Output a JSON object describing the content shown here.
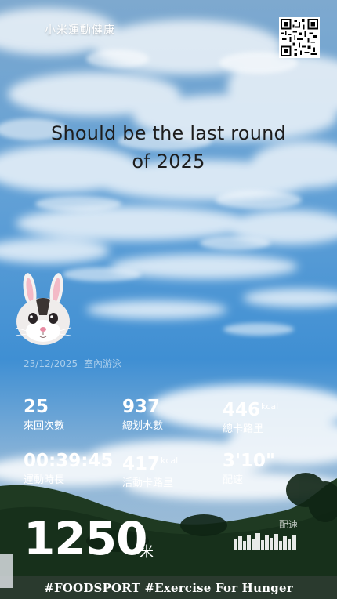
{
  "app": {
    "brand": "小米運動健康"
  },
  "headline": {
    "line1": "Should be the last round",
    "line2": "of 2025"
  },
  "workout": {
    "date": "23/12/2025",
    "type": "室內游泳"
  },
  "stats": [
    {
      "value": "25",
      "unit": "",
      "label": "來回次數"
    },
    {
      "value": "937",
      "unit": "",
      "label": "總划水數"
    },
    {
      "value": "446",
      "unit": "kcal",
      "label": "總卡路里"
    },
    {
      "value": "00:39:45",
      "unit": "",
      "label": "運動時長"
    },
    {
      "value": "417",
      "unit": "kcal",
      "label": "活動卡路里"
    },
    {
      "value": "3'10\"",
      "unit": "",
      "label": "配速"
    }
  ],
  "distance": {
    "value": "1250",
    "unit": "米"
  },
  "pace_chart": {
    "label": "配速"
  },
  "footer": {
    "hashtags": "#FOODSPORT #Exercise For Hunger"
  },
  "colors": {
    "sky": "#5f9fd6",
    "headline": "#1d1d1d",
    "text": "#ffffff"
  },
  "icons": [
    "qr-code-icon",
    "bunny-emoji-icon"
  ]
}
